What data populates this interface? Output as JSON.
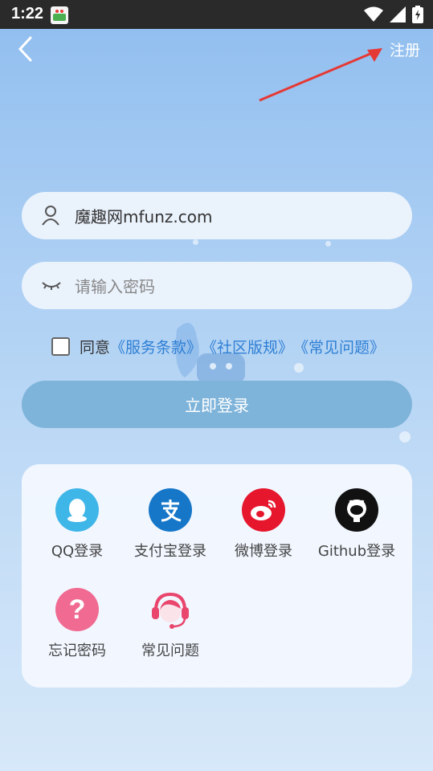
{
  "status_bar": {
    "time": "1:22"
  },
  "header": {
    "register_label": "注册"
  },
  "form": {
    "username_value": "魔趣网mfunz.com",
    "password_placeholder": "请输入密码",
    "agree_prefix": "同意",
    "links": [
      "《服务条款》",
      "《社区版规》",
      "《常见问题》"
    ],
    "login_label": "立即登录"
  },
  "options": [
    {
      "label": "QQ登录",
      "icon": "qq-icon",
      "color": "#3fb6e8"
    },
    {
      "label": "支付宝登录",
      "icon": "alipay-icon",
      "color": "#1677c9"
    },
    {
      "label": "微博登录",
      "icon": "weibo-icon",
      "color": "#e6162d"
    },
    {
      "label": "Github登录",
      "icon": "github-icon",
      "color": "#111111"
    },
    {
      "label": "忘记密码",
      "icon": "question-icon",
      "color": "#f06a92"
    },
    {
      "label": "常见问题",
      "icon": "headset-icon",
      "color": "#e9456d"
    }
  ],
  "colors": {
    "accent": "#2e7fd4",
    "login_button": "#7fb4da",
    "annotation_arrow": "#e53935"
  }
}
